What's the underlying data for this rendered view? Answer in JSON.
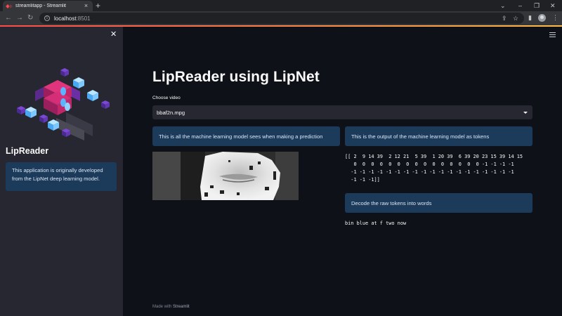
{
  "browser": {
    "tab_title": "streamlitapp - Streamlit",
    "new_tab": "+",
    "url_host": "localhost",
    "url_port": ":8501"
  },
  "sidebar": {
    "title": "LipReader",
    "info": "This application is originally developed from the LipNet deep learning model."
  },
  "main": {
    "title": "LipReader using LipNet",
    "select_label": "Choose video",
    "selected_video": "bbaf2n.mpg",
    "info_left": "This is all the machine learning model sees when making a prediction",
    "info_right": "This is the output of the machine learning model as tokens",
    "tokens": "[[ 2  9 14 39  2 12 21  5 39  1 20 39  6 39 20 23 15 39 14 15\n   0  0  0  0  0  0  0  0  0  0  0  0  0  0  0 -1 -1 -1 -1\n  -1 -1 -1 -1 -1 -1 -1 -1 -1 -1 -1 -1 -1 -1 -1 -1 -1 -1 -1\n  -1 -1 -1]]",
    "decode_label": "Decode the raw tokens into words",
    "decoded_text": "bin blue at f two now"
  },
  "footer": {
    "prefix": "Made with ",
    "brand": "Streamlit"
  },
  "colors": {
    "background": "#0e1117",
    "sidebar": "#262730",
    "info_box": "#1c3a5a",
    "accent": "#ff4b4b"
  },
  "icons": [
    "favicon-icon",
    "close-icon",
    "back-icon",
    "forward-icon",
    "reload-icon",
    "info-icon",
    "share-icon",
    "star-icon",
    "sidepanel-icon",
    "profile-icon",
    "menu-icon",
    "hamburger-icon",
    "caret-down-icon"
  ]
}
